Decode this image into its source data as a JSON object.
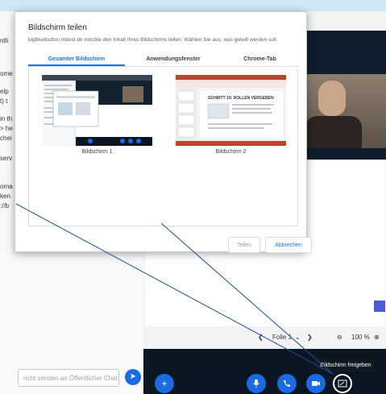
{
  "dialog": {
    "title": "Bildschirm teilen",
    "subtitle": "bigbluebutton.mbost.de möchte den Inhalt Ihres Bildschirms teilen. Wählen Sie aus, was geteilt werden soll.",
    "tabs": [
      {
        "label": "Gesamter Bildschirm",
        "active": true
      },
      {
        "label": "Anwendungsfenster",
        "active": false
      },
      {
        "label": "Chrome-Tab",
        "active": false
      }
    ],
    "screens": [
      {
        "label": "Bildschirm 1"
      },
      {
        "label": "Bildschirm 2",
        "slide_heading": "SCHRITT 19: ROLLEN VERGEBEN"
      }
    ],
    "share_label": "Teilen",
    "cancel_label": "Abbrechen"
  },
  "left_panel": {
    "fragments": [
      "ntli",
      "ome",
      "elp",
      "t) t",
      "in th",
      "> he",
      "chei",
      "serv",
      "oma",
      "ken",
      "://b"
    ],
    "chat_placeholder": "richt senden an Öffentlicher Chat"
  },
  "slide_nav": {
    "slide_label": "Folie 1",
    "zoom": "100 %"
  },
  "tooltip": "Bildschirm freigeben",
  "colors": {
    "accent": "#1a73e8",
    "bbb_blue": "#1b6be0",
    "dark_bar": "#0b1622"
  }
}
